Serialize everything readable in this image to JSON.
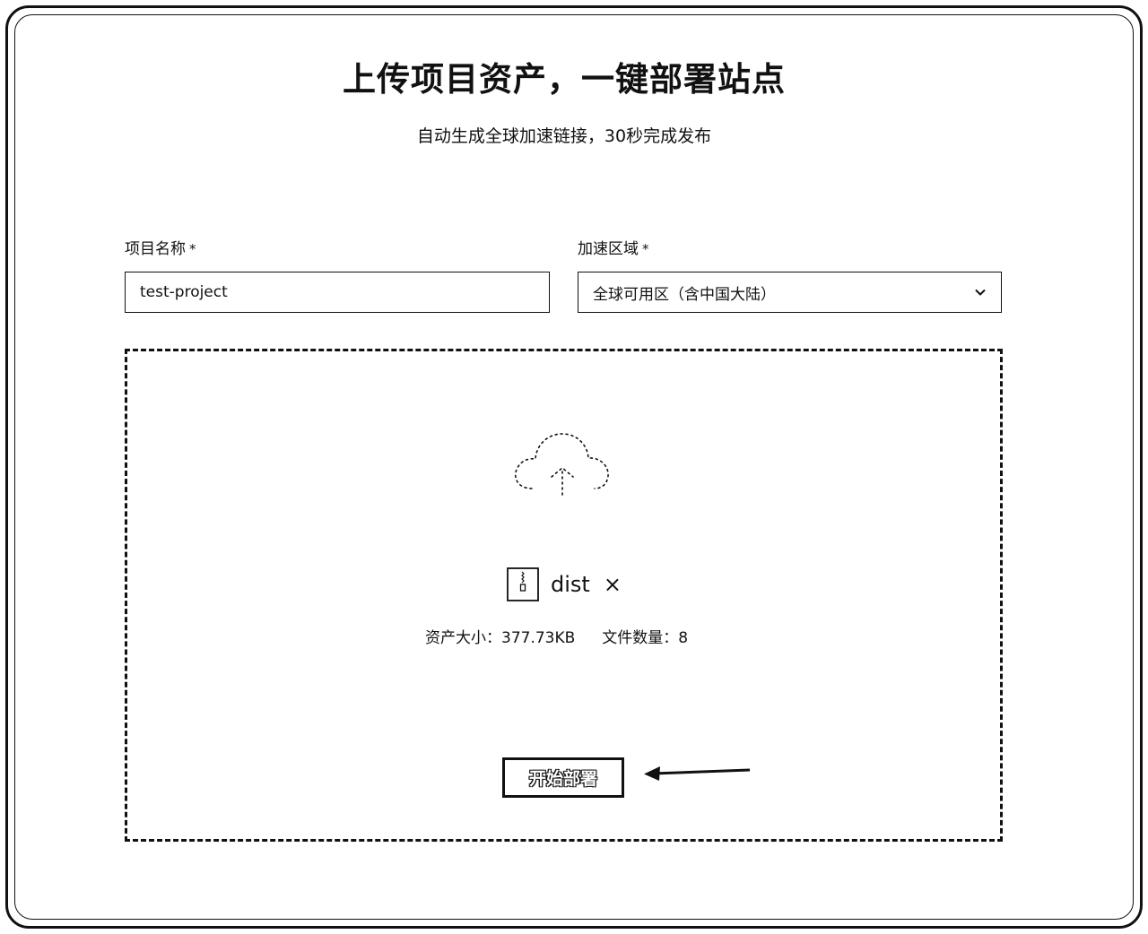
{
  "header": {
    "title": "上传项目资产，一键部署站点",
    "subtitle": "自动生成全球加速链接，30秒完成发布"
  },
  "form": {
    "project_name_label": "项目名称",
    "project_name_required": "*",
    "project_name_value": "test-project",
    "region_label": "加速区域",
    "region_required": "*",
    "region_selected": "全球可用区（含中国大陆）"
  },
  "upload": {
    "file_name": "dist",
    "remove_symbol": "×",
    "asset_size": "资产大小：377.73KB",
    "file_count": "文件数量：8"
  },
  "actions": {
    "deploy_label": "开始部署"
  },
  "icons": {
    "cloud": "cloud-upload-icon",
    "file": "zip-file-icon",
    "chevron": "chevron-down-icon",
    "arrow": "arrow-left-icon"
  }
}
